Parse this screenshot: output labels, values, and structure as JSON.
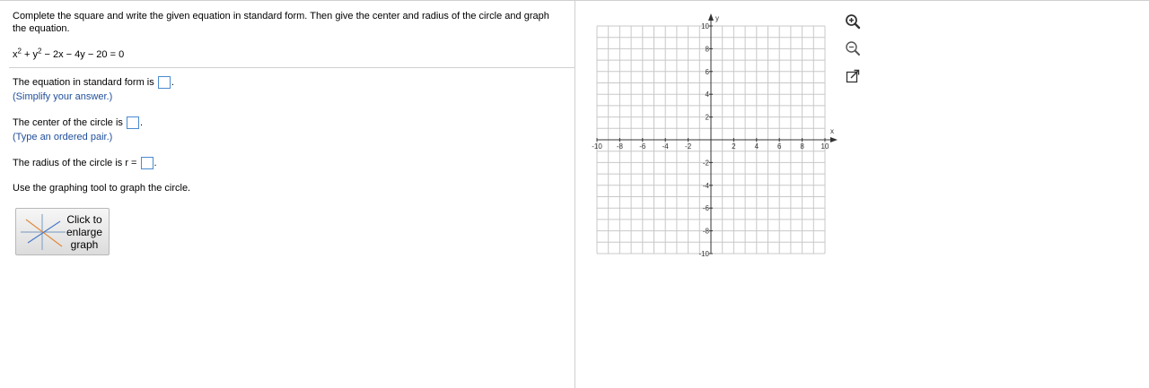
{
  "question": {
    "prompt": "Complete the square and write the given equation in standard form. Then give the center and radius of the circle and graph the equation.",
    "equation_parts": [
      "x",
      "2",
      " + y",
      "2",
      " − 2x − 4y − 20 = 0"
    ]
  },
  "answers": {
    "standard_form": {
      "label": "The equation in standard form is",
      "suffix": ".",
      "hint": "(Simplify your answer.)",
      "value": ""
    },
    "center": {
      "label": "The center of the circle is",
      "suffix": ".",
      "hint": "(Type an ordered pair.)",
      "value": ""
    },
    "radius": {
      "label": "The radius of the circle is r =",
      "suffix": ".",
      "value": ""
    }
  },
  "graph_instruction": "Use the graphing tool to graph the circle.",
  "enlarge_button": {
    "line1": "Click to",
    "line2": "enlarge",
    "line3": "graph"
  },
  "graph": {
    "x_axis_label": "x",
    "y_axis_label": "y",
    "x_range": [
      -10,
      10
    ],
    "y_range": [
      -10,
      10
    ],
    "grid_step": 1,
    "label_step": 2,
    "x_tick_labels": [
      "-10",
      "-8",
      "-6",
      "-4",
      "-2",
      "2",
      "4",
      "6",
      "8",
      "10"
    ],
    "y_tick_labels": [
      "10",
      "8",
      "6",
      "4",
      "2",
      "-2",
      "-4",
      "-6",
      "-8",
      "-10"
    ]
  },
  "tools": [
    {
      "name": "zoom-in",
      "icon": "zoom-in-icon"
    },
    {
      "name": "zoom-out",
      "icon": "zoom-out-icon"
    },
    {
      "name": "popout",
      "icon": "external-link-icon"
    }
  ],
  "colors": {
    "answer_box_border": "#4a8ad0",
    "hint_text": "#1f4e9a",
    "grid": "#c8c8c8",
    "axis": "#333333"
  }
}
